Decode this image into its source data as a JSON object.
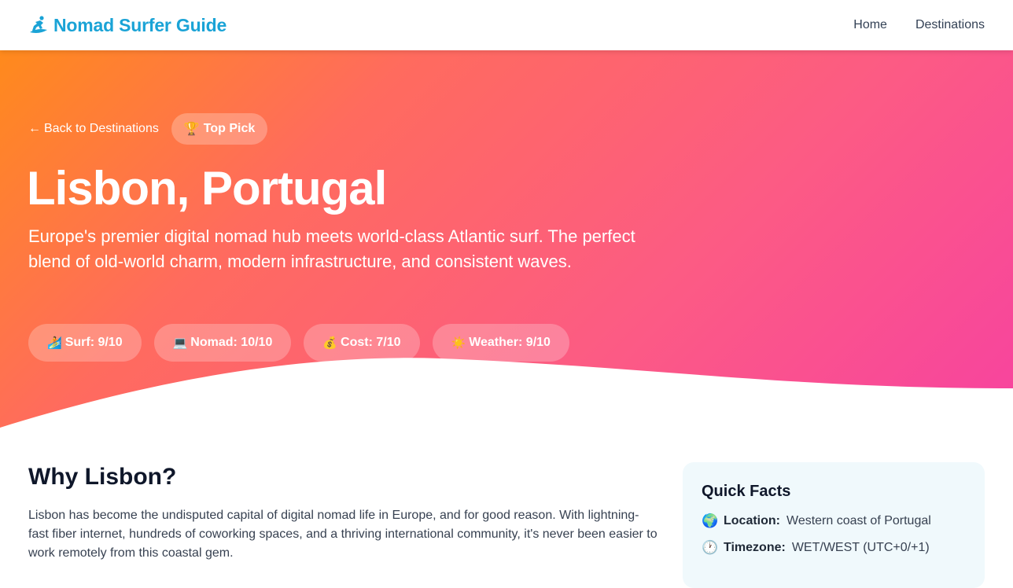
{
  "nav": {
    "brand": "Nomad Surfer Guide",
    "brand_icon": "surfer-icon",
    "links": [
      "Home",
      "Destinations"
    ]
  },
  "hero": {
    "back_label": "Back to Destinations",
    "badge_icon": "trophy-icon",
    "badge_label": "Top Pick",
    "title": "Lisbon, Portugal",
    "subtitle": "Europe's premier digital nomad hub meets world-class Atlantic surf. The perfect blend of old-world charm, modern infrastructure, and consistent waves.",
    "ratings": [
      {
        "icon": "surfer-icon",
        "glyph": "🏄",
        "label": "Surf: 9/10",
        "score": 9
      },
      {
        "icon": "laptop-icon",
        "glyph": "💻",
        "label": "Nomad: 10/10",
        "score": 10
      },
      {
        "icon": "money-bag-icon",
        "glyph": "💰",
        "label": "Cost: 7/10",
        "score": 7
      },
      {
        "icon": "sun-icon",
        "glyph": "☀️",
        "label": "Weather: 9/10",
        "score": 9
      }
    ]
  },
  "content": {
    "heading": "Why Lisbon?",
    "body": "Lisbon has become the undisputed capital of digital nomad life in Europe, and for good reason. With lightning-fast fiber internet, hundreds of coworking spaces, and a thriving international community, it's never been easier to work remotely from this coastal gem."
  },
  "quick_facts": {
    "title": "Quick Facts",
    "items": [
      {
        "icon": "globe-icon",
        "glyph": "🌍",
        "label": "Location:",
        "value": "Western coast of Portugal"
      },
      {
        "icon": "clock-icon",
        "glyph": "🕐",
        "label": "Timezone:",
        "value": "WET/WEST (UTC+0/+1)"
      }
    ]
  },
  "colors": {
    "brand": "#1aa3d6",
    "hero_gradient_start": "#ff8a1c",
    "hero_gradient_end": "#f7439f",
    "facts_bg": "#f0f9fc"
  }
}
